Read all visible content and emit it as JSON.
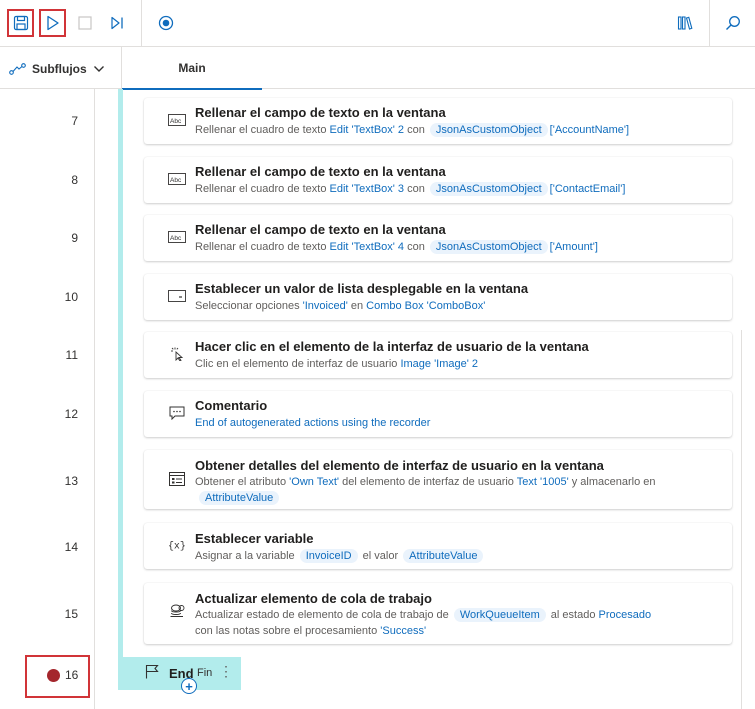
{
  "toolbar": {
    "save_icon": "save-icon",
    "run_icon": "play-icon",
    "stop_icon": "stop-icon",
    "step_icon": "run-next-action-icon",
    "record_icon": "record-icon",
    "assets_icon": "library-icon",
    "search_icon": "search-icon"
  },
  "subflows": {
    "label": "Subflujos"
  },
  "tab": {
    "label": "Main"
  },
  "actions": [
    {
      "num": "7",
      "icon": "textbox-icon",
      "title": "Rellenar el campo de texto en la ventana",
      "desc": {
        "p1": "Rellenar el cuadro de texto ",
        "link1": "Edit 'TextBox' 2",
        "p2": " con ",
        "chip1": "JsonAsCustomObject",
        "link2": "['AccountName']"
      }
    },
    {
      "num": "8",
      "icon": "textbox-icon",
      "title": "Rellenar el campo de texto en la ventana",
      "desc": {
        "p1": "Rellenar el cuadro de texto ",
        "link1": "Edit 'TextBox' 3",
        "p2": " con ",
        "chip1": "JsonAsCustomObject",
        "link2": "['ContactEmail']"
      }
    },
    {
      "num": "9",
      "icon": "textbox-icon",
      "title": "Rellenar el campo de texto en la ventana",
      "desc": {
        "p1": "Rellenar el cuadro de texto ",
        "link1": "Edit 'TextBox' 4",
        "p2": " con ",
        "chip1": "JsonAsCustomObject",
        "link2": "['Amount']"
      }
    },
    {
      "num": "10",
      "icon": "dropdown-icon",
      "title": "Establecer un valor de lista desplegable en la ventana",
      "desc": {
        "p1": "Seleccionar opciones ",
        "link1": "'Invoiced'",
        "p2": " en ",
        "link2": "Combo Box 'ComboBox'"
      }
    },
    {
      "num": "11",
      "icon": "click-icon",
      "title": "Hacer clic en el elemento de la interfaz de usuario de la ventana",
      "desc": {
        "p1": "Clic en el elemento de interfaz de usuario ",
        "link1": "Image 'Image' 2"
      }
    },
    {
      "num": "12",
      "icon": "comment-icon",
      "title": "Comentario",
      "desc": {
        "link1": "End of autogenerated actions using the recorder"
      }
    },
    {
      "num": "13",
      "icon": "details-icon",
      "title": "Obtener detalles del elemento de interfaz de usuario en la ventana",
      "desc": {
        "p1": "Obtener el atributo ",
        "link1": "'Own Text'",
        "p2": " del elemento de interfaz de usuario ",
        "link2": "Text '1005'",
        "p3": " y almacenarlo en",
        "chip1": "AttributeValue"
      }
    },
    {
      "num": "14",
      "icon": "variable-icon",
      "title": "Establecer variable",
      "desc": {
        "p1": "Asignar a la variable ",
        "chip1": "InvoiceID",
        "p2": " el valor ",
        "chip2": "AttributeValue"
      }
    },
    {
      "num": "15",
      "icon": "work-queue-icon",
      "title": "Actualizar elemento de cola de trabajo",
      "desc": {
        "p1": "Actualizar estado de elemento de cola de trabajo de ",
        "chip1": "WorkQueueItem",
        "p2": " al estado ",
        "link1": "Procesado",
        "p3": "con las notas sobre el procesamiento ",
        "link2": "'Success'"
      }
    }
  ],
  "end": {
    "num": "16",
    "label": "End",
    "sub": "Fin",
    "more": "⋮",
    "plus": "+"
  },
  "colors": {
    "accent": "#0f6cbd",
    "scope": "#b2ecec",
    "breakpoint": "#a4262c",
    "highlight": "#d13438"
  }
}
